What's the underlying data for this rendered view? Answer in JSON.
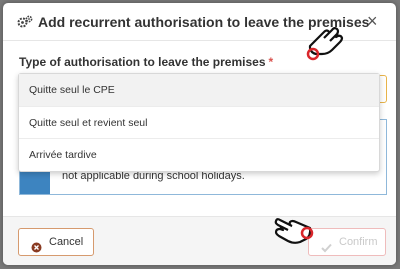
{
  "dialog": {
    "title": "Add recurrent authorisation to leave the premises",
    "close_glyph": "×",
    "title_icon": "gears-icon"
  },
  "form": {
    "field_label": "Type of authorisation to leave the premises",
    "required_mark": "*",
    "select_border_color": "#e8b44a"
  },
  "dropdown": {
    "options": [
      {
        "label": "Quitte seul le CPE",
        "highlighted": true
      },
      {
        "label": "Quitte seul et revient seul",
        "highlighted": false
      },
      {
        "label": "Arrivée tardive",
        "highlighted": false
      }
    ]
  },
  "info": {
    "text": "not applicable during school holidays.",
    "accent_color": "#3d84c0"
  },
  "footer": {
    "cancel_label": "Cancel",
    "confirm_label": "Confirm",
    "confirm_enabled": false
  }
}
